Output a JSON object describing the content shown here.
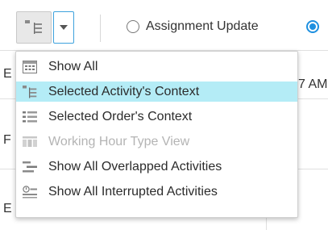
{
  "toolbar": {
    "view_button_icon": "selected-activity-context-icon",
    "dropdown_icon": "chevron-down-icon",
    "radio_assignment_label": "Assignment Update",
    "radio_assignment_checked": false,
    "radio_other_checked": true
  },
  "background": {
    "row1_left": "E",
    "row1_right": "7 AM",
    "row2_left": "F",
    "row3_left": "E"
  },
  "menu": {
    "items": [
      {
        "label": "Show All",
        "icon": "calendar-grid-icon",
        "highlighted": false,
        "enabled": true
      },
      {
        "label": "Selected Activity's Context",
        "icon": "selected-activity-context-icon",
        "highlighted": true,
        "enabled": true
      },
      {
        "label": "Selected Order's Context",
        "icon": "order-context-icon",
        "highlighted": false,
        "enabled": true
      },
      {
        "label": "Working Hour Type View",
        "icon": "working-hour-type-icon",
        "highlighted": false,
        "enabled": false
      },
      {
        "label": "Show All Overlapped Activities",
        "icon": "overlapped-activities-icon",
        "highlighted": false,
        "enabled": true
      },
      {
        "label": "Show All Interrupted Activities",
        "icon": "interrupted-activities-icon",
        "highlighted": false,
        "enabled": true
      }
    ]
  },
  "colors": {
    "highlight": "#b4ecf6",
    "accent_blue": "#1e90e0",
    "disabled_text": "#b4b4b4"
  }
}
